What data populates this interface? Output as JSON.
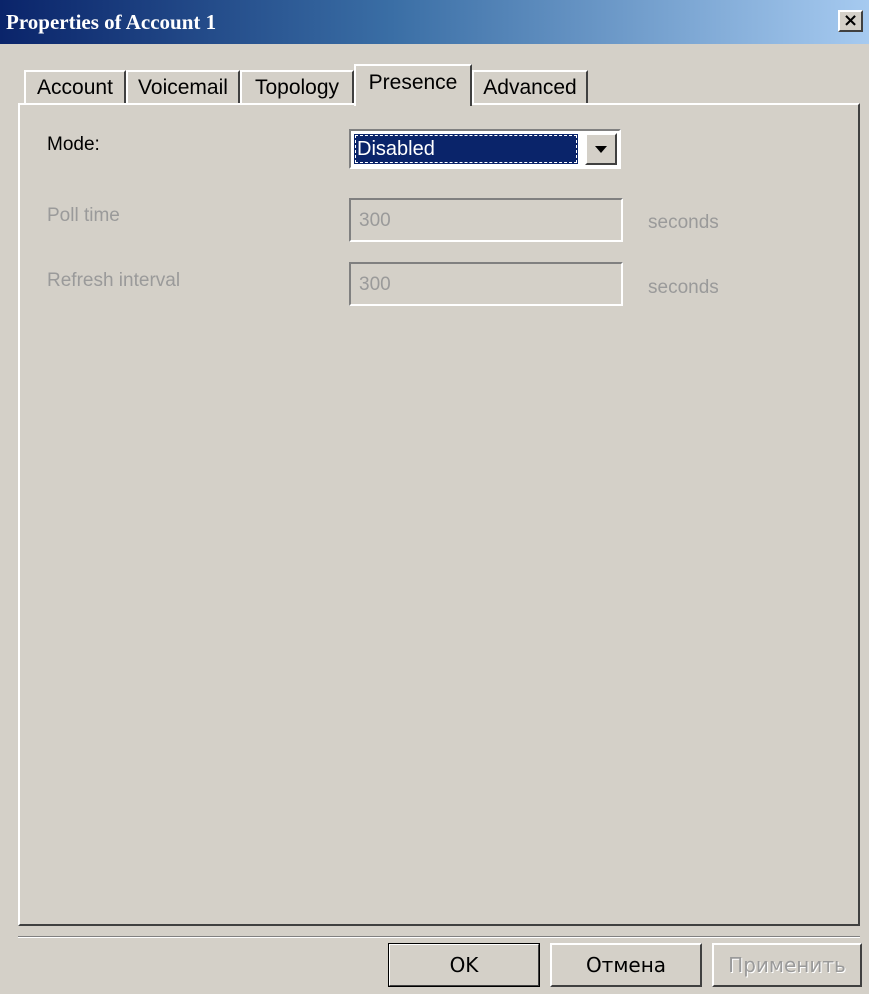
{
  "window": {
    "title": "Properties of Account 1",
    "close_glyph": "×"
  },
  "tabs": [
    {
      "label": "Account"
    },
    {
      "label": "Voicemail"
    },
    {
      "label": "Topology"
    },
    {
      "label": "Presence",
      "active": true
    },
    {
      "label": "Advanced"
    }
  ],
  "presence": {
    "mode_label": "Mode:",
    "mode_value": "Disabled",
    "poll_time_label": "Poll time",
    "poll_time_value": "300",
    "poll_time_unit": "seconds",
    "refresh_interval_label": "Refresh interval",
    "refresh_interval_value": "300",
    "refresh_interval_unit": "seconds"
  },
  "buttons": {
    "ok": "OK",
    "cancel": "Отмена",
    "apply": "Применить"
  },
  "colors": {
    "title_gradient_start": "#0a246a",
    "title_gradient_end": "#a6caf0",
    "dialog_bg": "#d4d0c8",
    "selection_bg": "#0a246a",
    "disabled_text": "#9a9a9a"
  },
  "icons": {
    "close": "close-icon",
    "dropdown": "chevron-down-icon"
  }
}
